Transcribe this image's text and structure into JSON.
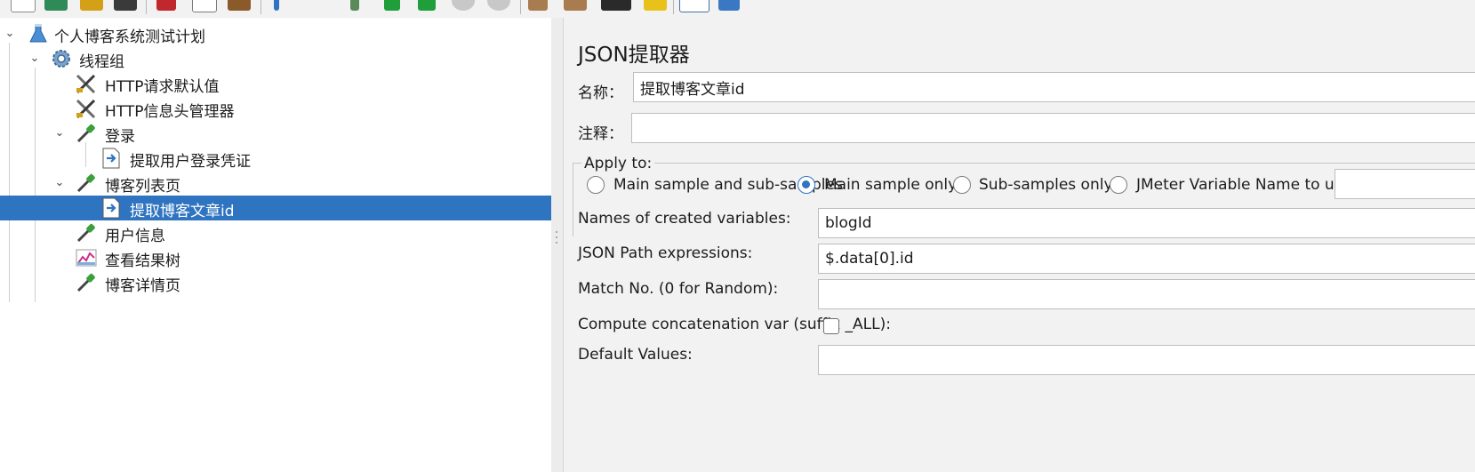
{
  "toolbar": {
    "icons": [
      "new-icon",
      "templates-icon",
      "open-icon",
      "save-icon",
      "cut-icon",
      "copy-icon",
      "paste-icon",
      "expand-icon",
      "collapse-icon",
      "start-icon",
      "start-no-pause-icon",
      "stop-icon",
      "shutdown-icon",
      "clear-icon",
      "clear-all-icon",
      "search-icon",
      "reset-search-icon",
      "function-helper-icon",
      "help-icon"
    ]
  },
  "tree": {
    "nodes": [
      {
        "label": "个人博客系统测试计划",
        "icon": "test-plan-icon",
        "expanded": true
      },
      {
        "label": "线程组",
        "icon": "thread-group-gear-icon",
        "expanded": true
      },
      {
        "label": "HTTP请求默认值",
        "icon": "config-tools-icon"
      },
      {
        "label": "HTTP信息头管理器",
        "icon": "config-tools-icon"
      },
      {
        "label": "登录",
        "icon": "sampler-pipette-icon",
        "expanded": true
      },
      {
        "label": "提取用户登录凭证",
        "icon": "post-processor-icon"
      },
      {
        "label": "博客列表页",
        "icon": "sampler-pipette-icon",
        "expanded": true
      },
      {
        "label": "提取博客文章id",
        "icon": "post-processor-icon",
        "selected": true
      },
      {
        "label": "用户信息",
        "icon": "sampler-pipette-icon"
      },
      {
        "label": "查看结果树",
        "icon": "listener-graph-icon"
      },
      {
        "label": "博客详情页",
        "icon": "sampler-pipette-icon"
      }
    ]
  },
  "panel": {
    "title": "JSON提取器",
    "name_label": "名称：",
    "name_value": "提取博客文章id",
    "comment_label": "注释：",
    "comment_value": "",
    "apply_to": {
      "legend": "Apply to:",
      "options": [
        {
          "label": "Main sample and sub-samples",
          "selected": false
        },
        {
          "label": "Main sample only",
          "selected": true
        },
        {
          "label": "Sub-samples only",
          "selected": false
        },
        {
          "label": "JMeter Variable Name to use",
          "selected": false
        }
      ],
      "variable_value": ""
    },
    "names_label": "Names of created variables:",
    "names_value": "blogId",
    "paths_label": "JSON Path expressions:",
    "paths_value": "$.data[0].id",
    "match_label": "Match No. (0 for Random):",
    "match_value": "",
    "concat_label": "Compute concatenation var (suffix _ALL):",
    "concat_checked": false,
    "default_label": "Default Values:",
    "default_value": ""
  },
  "colors": {
    "selection": "#2f74c0",
    "panel_bg": "#f2f2f2",
    "tree_bg": "#ffffff"
  }
}
